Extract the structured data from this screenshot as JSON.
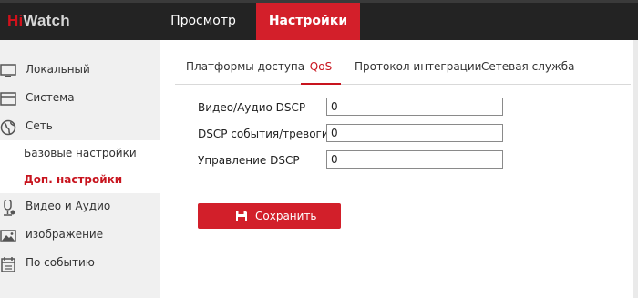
{
  "app": {
    "logo_hi": "Hi",
    "logo_rest": "Watch"
  },
  "top_nav": {
    "tabs": [
      {
        "label": "Просмотр",
        "active": false
      },
      {
        "label": "Настройки",
        "active": true
      }
    ]
  },
  "sidebar": {
    "items": [
      {
        "label": "Локальный",
        "icon": "monitor-icon"
      },
      {
        "label": "Система",
        "icon": "window-icon"
      },
      {
        "label": "Сеть",
        "icon": "globe-icon"
      },
      {
        "label": "Видео и Аудио",
        "icon": "camera-mic-icon"
      },
      {
        "label": "изображение",
        "icon": "image-icon"
      },
      {
        "label": "По событию",
        "icon": "calendar-icon"
      }
    ],
    "sub_items": [
      {
        "label": "Базовые настройки",
        "active": false
      },
      {
        "label": "Доп. настройки",
        "active": true
      }
    ]
  },
  "content_tabs": [
    {
      "label": "Платформы доступа",
      "active": false
    },
    {
      "label": "QoS",
      "active": true
    },
    {
      "label": "Протокол интеграции",
      "active": false
    },
    {
      "label": "Сетевая служба",
      "active": false
    }
  ],
  "form": {
    "fields": [
      {
        "label": "Видео/Аудио DSCP",
        "value": "0"
      },
      {
        "label": "DSCP события/тревоги",
        "value": "0"
      },
      {
        "label": "Управление DSCP",
        "value": "0"
      }
    ],
    "save_label": "Сохранить"
  },
  "colors": {
    "accent": "#d31f2a",
    "topbar": "#232323",
    "sidebar": "#f0f0f0"
  }
}
